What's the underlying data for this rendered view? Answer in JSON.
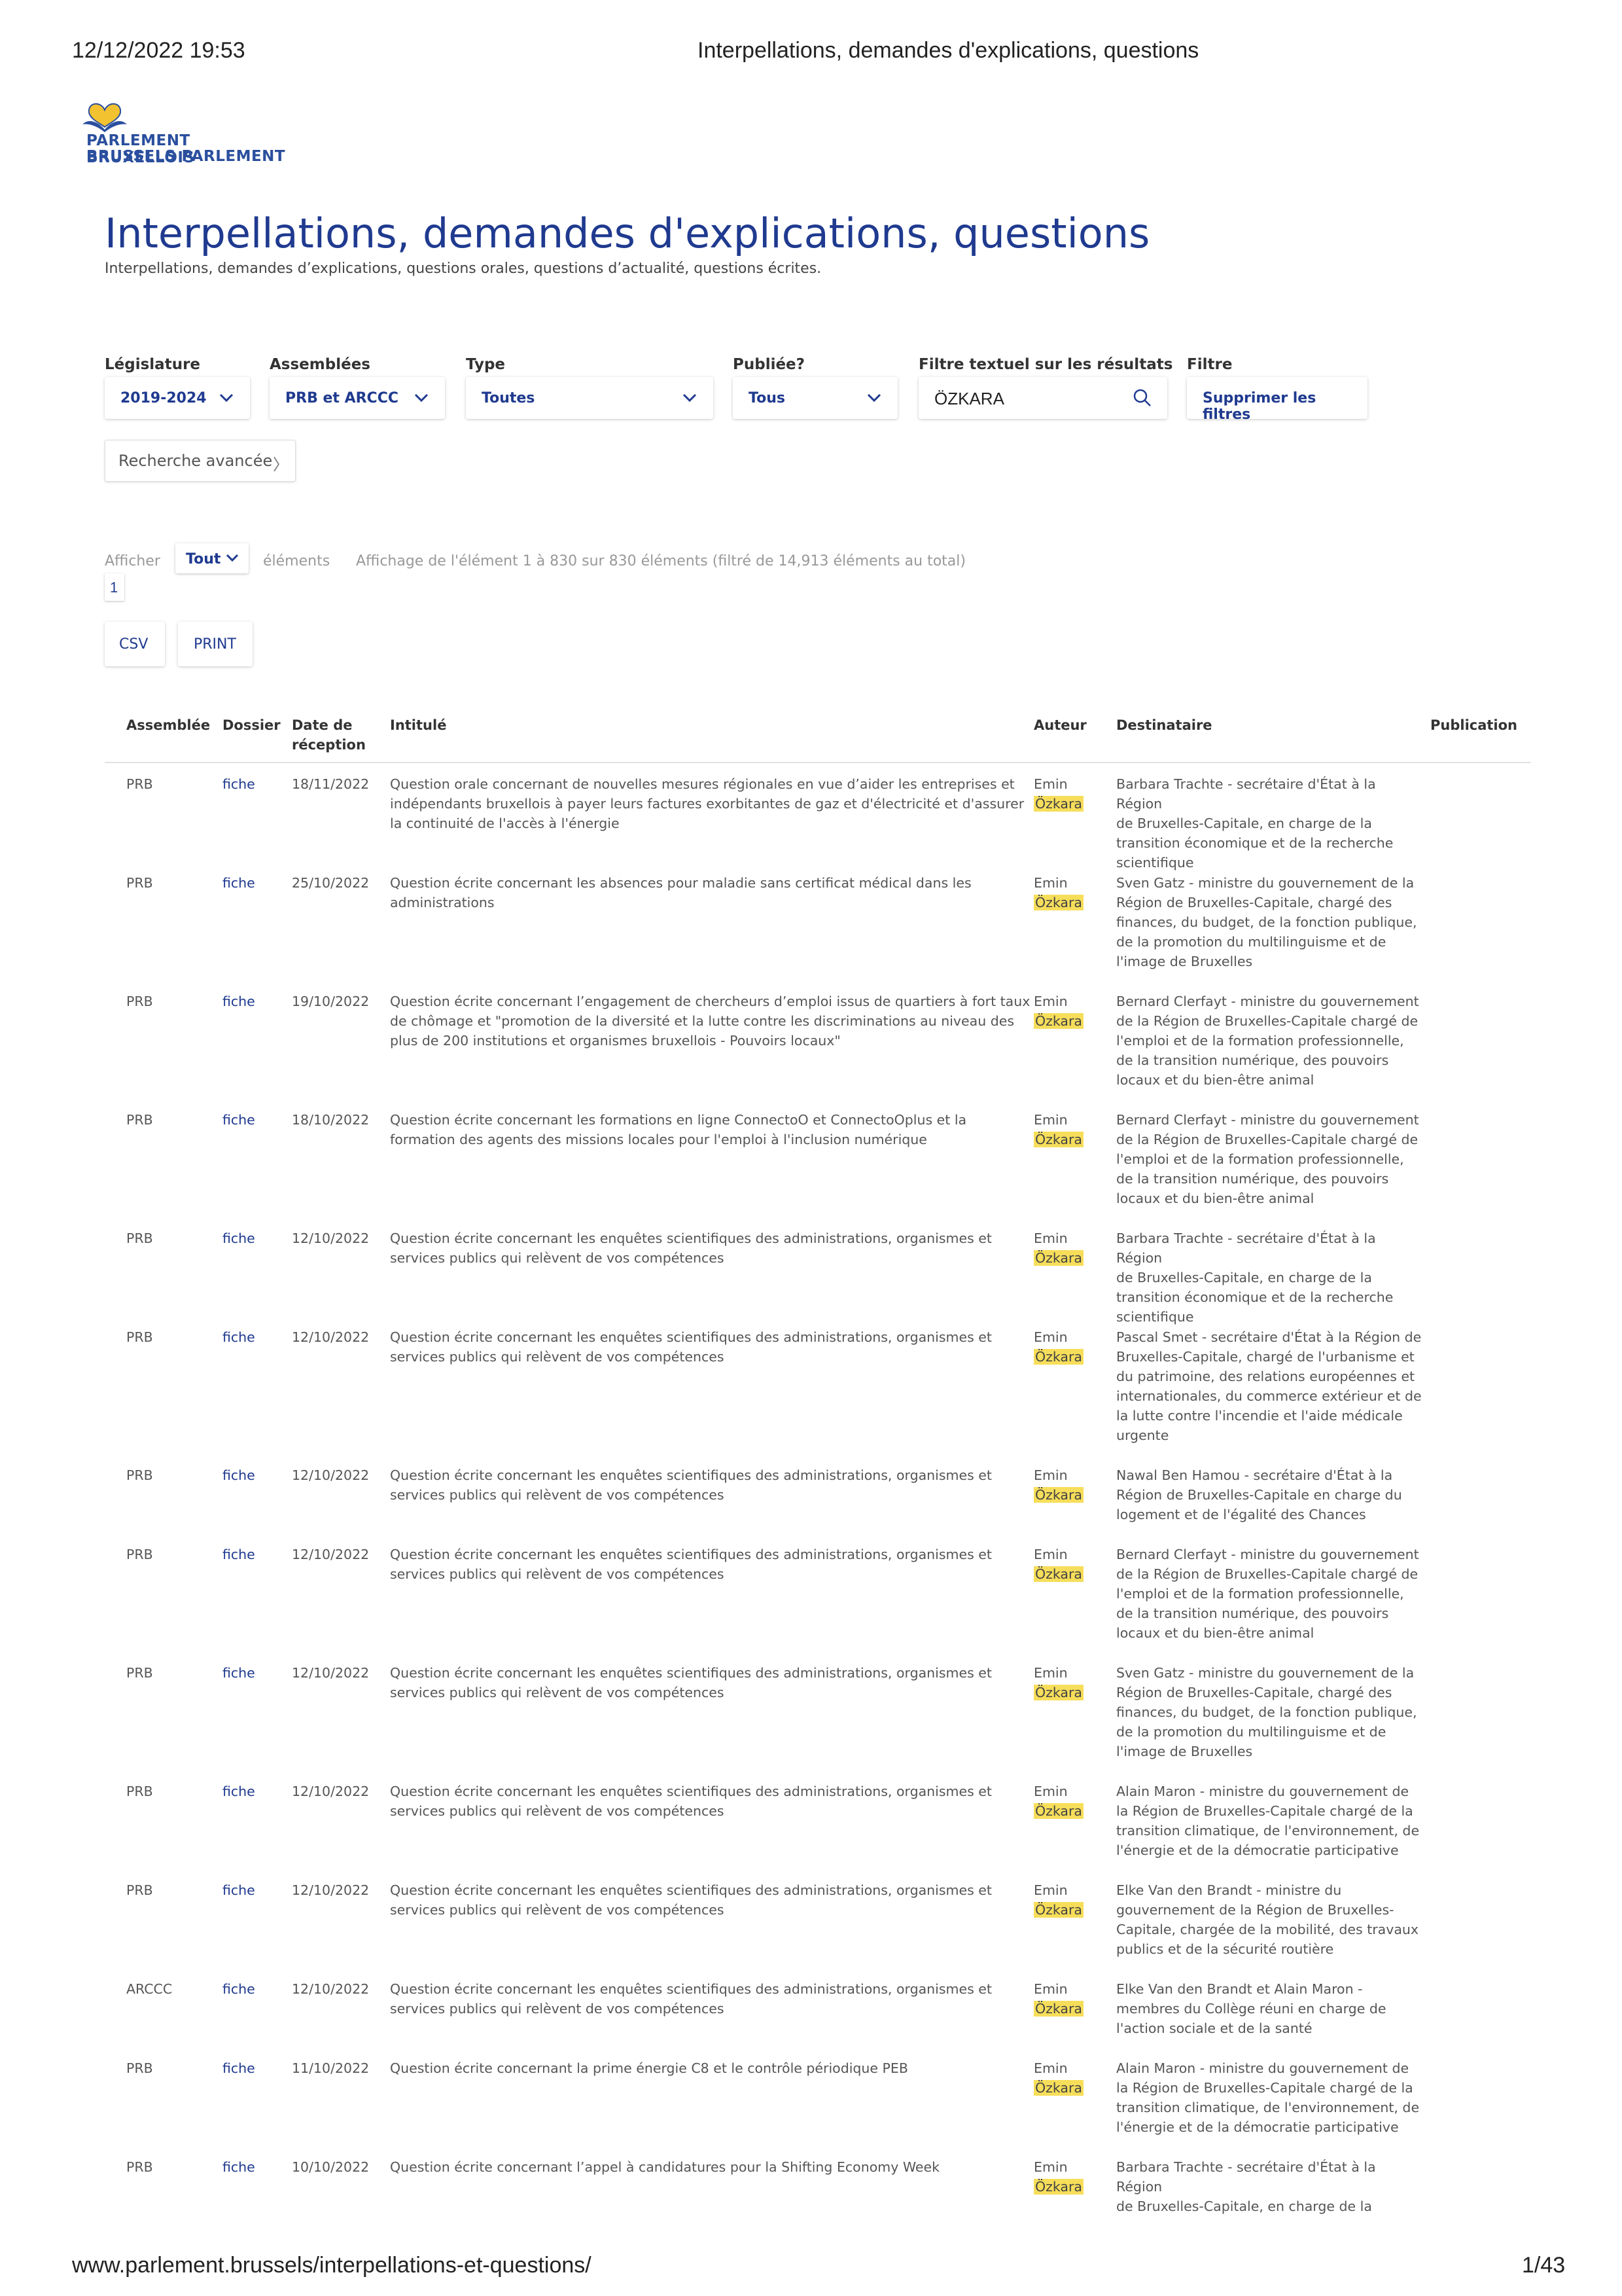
{
  "print_header": {
    "datetime": "12/12/2022 19:53",
    "title": "Interpellations, demandes d'explications, questions"
  },
  "logo": {
    "line1": "PARLEMENT BRUXELLOIS",
    "line2": "BRUSSELS PARLEMENT",
    "colors": {
      "heart_blue": "#2b4f9e",
      "heart_yellow": "#f2c230"
    }
  },
  "page": {
    "title": "Interpellations, demandes d'explications, questions",
    "subtitle": "Interpellations, demandes d’explications, questions orales, questions d’actualité, questions écrites."
  },
  "filters": {
    "legislature_label": "Législature",
    "legislature_value": "2019-2024",
    "assemblees_label": "Assemblées",
    "assemblees_value": "PRB et ARCCC",
    "type_label": "Type",
    "type_value": "Toutes",
    "publiee_label": "Publiée?",
    "publiee_value": "Tous",
    "text_filter_label": "Filtre textuel sur les résultats",
    "text_filter_value": "ÖZKARA",
    "filtre_label": "Filtre",
    "clear_label": "Supprimer les filtres",
    "advanced_label": "Recherche avancée",
    "advanced_arrow": "〉"
  },
  "listing": {
    "show_label": "Afficher",
    "show_value": "Tout",
    "elements_label": "éléments",
    "info": "Affichage de l'élément 1 à 830 sur 830 éléments (filtré de 14,913 éléments au total)",
    "page": "1",
    "csv_label": "CSV",
    "print_label": "PRINT"
  },
  "table": {
    "headers": {
      "assemblee": "Assemblée",
      "dossier": "Dossier",
      "date1": "Date de",
      "date2": "réception",
      "intitule": "Intitulé",
      "auteur": "Auteur",
      "destinataire": "Destinataire",
      "publication": "Publication"
    },
    "rows": [
      {
        "assemblee": "PRB",
        "dossier": "fiche",
        "date": "18/11/2022",
        "intitule": [
          "Question orale concernant de nouvelles mesures régionales en vue d’aider les entreprises et",
          "indépendants bruxellois à payer leurs factures exorbitantes de gaz et d'électricité et d'assurer",
          "la continuité de l'accès à l'énergie"
        ],
        "auteur_first": "Emin",
        "auteur_last": "Özkara",
        "destinataire": [
          "Barbara Trachte - secrétaire d'État à la Région",
          "de Bruxelles-Capitale, en charge de la",
          "transition économique et de la recherche",
          "scientifique"
        ]
      },
      {
        "assemblee": "PRB",
        "dossier": "fiche",
        "date": "25/10/2022",
        "intitule": [
          "Question écrite concernant les absences pour maladie sans certificat médical dans les",
          "administrations"
        ],
        "auteur_first": "Emin",
        "auteur_last": "Özkara",
        "destinataire": [
          "Sven Gatz - ministre du gouvernement de la",
          "Région de Bruxelles-Capitale, chargé des",
          "finances, du budget, de la fonction publique,",
          "de la promotion du multilinguisme et de",
          "l'image de Bruxelles"
        ]
      },
      {
        "assemblee": "PRB",
        "dossier": "fiche",
        "date": "19/10/2022",
        "intitule": [
          "Question écrite concernant l’engagement de chercheurs d’emploi issus de quartiers à fort taux",
          "de chômage et \"promotion de la diversité et la lutte contre les discriminations au niveau des",
          "plus de 200 institutions et organismes bruxellois - Pouvoirs locaux\""
        ],
        "auteur_first": "Emin",
        "auteur_last": "Özkara",
        "destinataire": [
          "Bernard Clerfayt - ministre du gouvernement",
          "de la Région de Bruxelles-Capitale chargé de",
          "l'emploi et de la formation professionnelle,",
          "de la transition numérique, des pouvoirs",
          "locaux et du bien-être animal"
        ]
      },
      {
        "assemblee": "PRB",
        "dossier": "fiche",
        "date": "18/10/2022",
        "intitule": [
          "Question écrite concernant les formations en ligne ConnectoO et ConnectoOplus et la",
          "formation des agents des missions locales pour l'emploi à l'inclusion numérique"
        ],
        "auteur_first": "Emin",
        "auteur_last": "Özkara",
        "destinataire": [
          "Bernard Clerfayt - ministre du gouvernement",
          "de la Région de Bruxelles-Capitale chargé de",
          "l'emploi et de la formation professionnelle,",
          "de la transition numérique, des pouvoirs",
          "locaux et du bien-être animal"
        ]
      },
      {
        "assemblee": "PRB",
        "dossier": "fiche",
        "date": "12/10/2022",
        "intitule": [
          "Question écrite concernant les enquêtes scientifiques des administrations, organismes et",
          "services publics qui relèvent de vos compétences"
        ],
        "auteur_first": "Emin",
        "auteur_last": "Özkara",
        "destinataire": [
          "Barbara Trachte - secrétaire d'État à la Région",
          "de Bruxelles-Capitale, en charge de la",
          "transition économique et de la recherche",
          "scientifique"
        ]
      },
      {
        "assemblee": "PRB",
        "dossier": "fiche",
        "date": "12/10/2022",
        "intitule": [
          "Question écrite concernant les enquêtes scientifiques des administrations, organismes et",
          "services publics qui relèvent de vos compétences"
        ],
        "auteur_first": "Emin",
        "auteur_last": "Özkara",
        "destinataire": [
          "Pascal Smet - secrétaire d'État à la Région de",
          "Bruxelles-Capitale, chargé de l'urbanisme et",
          "du patrimoine, des relations européennes et",
          "internationales, du commerce extérieur et de",
          "la lutte contre l'incendie et l'aide médicale",
          "urgente"
        ]
      },
      {
        "assemblee": "PRB",
        "dossier": "fiche",
        "date": "12/10/2022",
        "intitule": [
          "Question écrite concernant les enquêtes scientifiques des administrations, organismes et",
          "services publics qui relèvent de vos compétences"
        ],
        "auteur_first": "Emin",
        "auteur_last": "Özkara",
        "destinataire": [
          "Nawal Ben Hamou - secrétaire d'État à la",
          "Région de Bruxelles-Capitale en charge du",
          "logement et de l'égalité des Chances"
        ]
      },
      {
        "assemblee": "PRB",
        "dossier": "fiche",
        "date": "12/10/2022",
        "intitule": [
          "Question écrite concernant les enquêtes scientifiques des administrations, organismes et",
          "services publics qui relèvent de vos compétences"
        ],
        "auteur_first": "Emin",
        "auteur_last": "Özkara",
        "destinataire": [
          "Bernard Clerfayt - ministre du gouvernement",
          "de la Région de Bruxelles-Capitale chargé de",
          "l'emploi et de la formation professionnelle,",
          "de la transition numérique, des pouvoirs",
          "locaux et du bien-être animal"
        ]
      },
      {
        "assemblee": "PRB",
        "dossier": "fiche",
        "date": "12/10/2022",
        "intitule": [
          "Question écrite concernant les enquêtes scientifiques des administrations, organismes et",
          "services publics qui relèvent de vos compétences"
        ],
        "auteur_first": "Emin",
        "auteur_last": "Özkara",
        "destinataire": [
          "Sven Gatz - ministre du gouvernement de la",
          "Région de Bruxelles-Capitale, chargé des",
          "finances, du budget, de la fonction publique,",
          "de la promotion du multilinguisme et de",
          "l'image de Bruxelles"
        ]
      },
      {
        "assemblee": "PRB",
        "dossier": "fiche",
        "date": "12/10/2022",
        "intitule": [
          "Question écrite concernant les enquêtes scientifiques des administrations, organismes et",
          "services publics qui relèvent de vos compétences"
        ],
        "auteur_first": "Emin",
        "auteur_last": "Özkara",
        "destinataire": [
          "Alain Maron - ministre du gouvernement de",
          "la Région de Bruxelles-Capitale chargé de la",
          "transition climatique, de l'environnement, de",
          "l'énergie et de la démocratie participative"
        ]
      },
      {
        "assemblee": "PRB",
        "dossier": "fiche",
        "date": "12/10/2022",
        "intitule": [
          "Question écrite concernant les enquêtes scientifiques des administrations, organismes et",
          "services publics qui relèvent de vos compétences"
        ],
        "auteur_first": "Emin",
        "auteur_last": "Özkara",
        "destinataire": [
          "Elke Van den Brandt - ministre du",
          "gouvernement de la Région de Bruxelles-",
          "Capitale, chargée de la mobilité, des travaux",
          "publics et de la sécurité routière"
        ]
      },
      {
        "assemblee": "ARCCC",
        "dossier": "fiche",
        "date": "12/10/2022",
        "intitule": [
          "Question écrite concernant  les enquêtes scientifiques des administrations, organismes et",
          "services publics qui relèvent de vos compétences"
        ],
        "auteur_first": "Emin",
        "auteur_last": "Özkara",
        "destinataire": [
          "Elke Van den Brandt et Alain Maron -",
          "membres du Collège réuni en charge de",
          "l'action sociale et de la santé"
        ]
      },
      {
        "assemblee": "PRB",
        "dossier": "fiche",
        "date": "11/10/2022",
        "intitule": [
          "Question écrite concernant la prime énergie C8 et le contrôle périodique PEB"
        ],
        "auteur_first": "Emin",
        "auteur_last": "Özkara",
        "destinataire": [
          "Alain Maron - ministre du gouvernement de",
          "la Région de Bruxelles-Capitale chargé de la",
          "transition climatique, de l'environnement, de",
          "l'énergie et de la démocratie participative"
        ]
      },
      {
        "assemblee": "PRB",
        "dossier": "fiche",
        "date": "10/10/2022",
        "intitule": [
          "Question écrite concernant l’appel à candidatures pour la Shifting Economy Week"
        ],
        "auteur_first": "Emin",
        "auteur_last": "Özkara",
        "destinataire": [
          "Barbara Trachte - secrétaire d'État à la Région",
          "de Bruxelles-Capitale, en charge de la"
        ]
      }
    ]
  },
  "print_footer": {
    "url": "www.parlement.brussels/interpellations-et-questions/",
    "page": "1/43"
  }
}
